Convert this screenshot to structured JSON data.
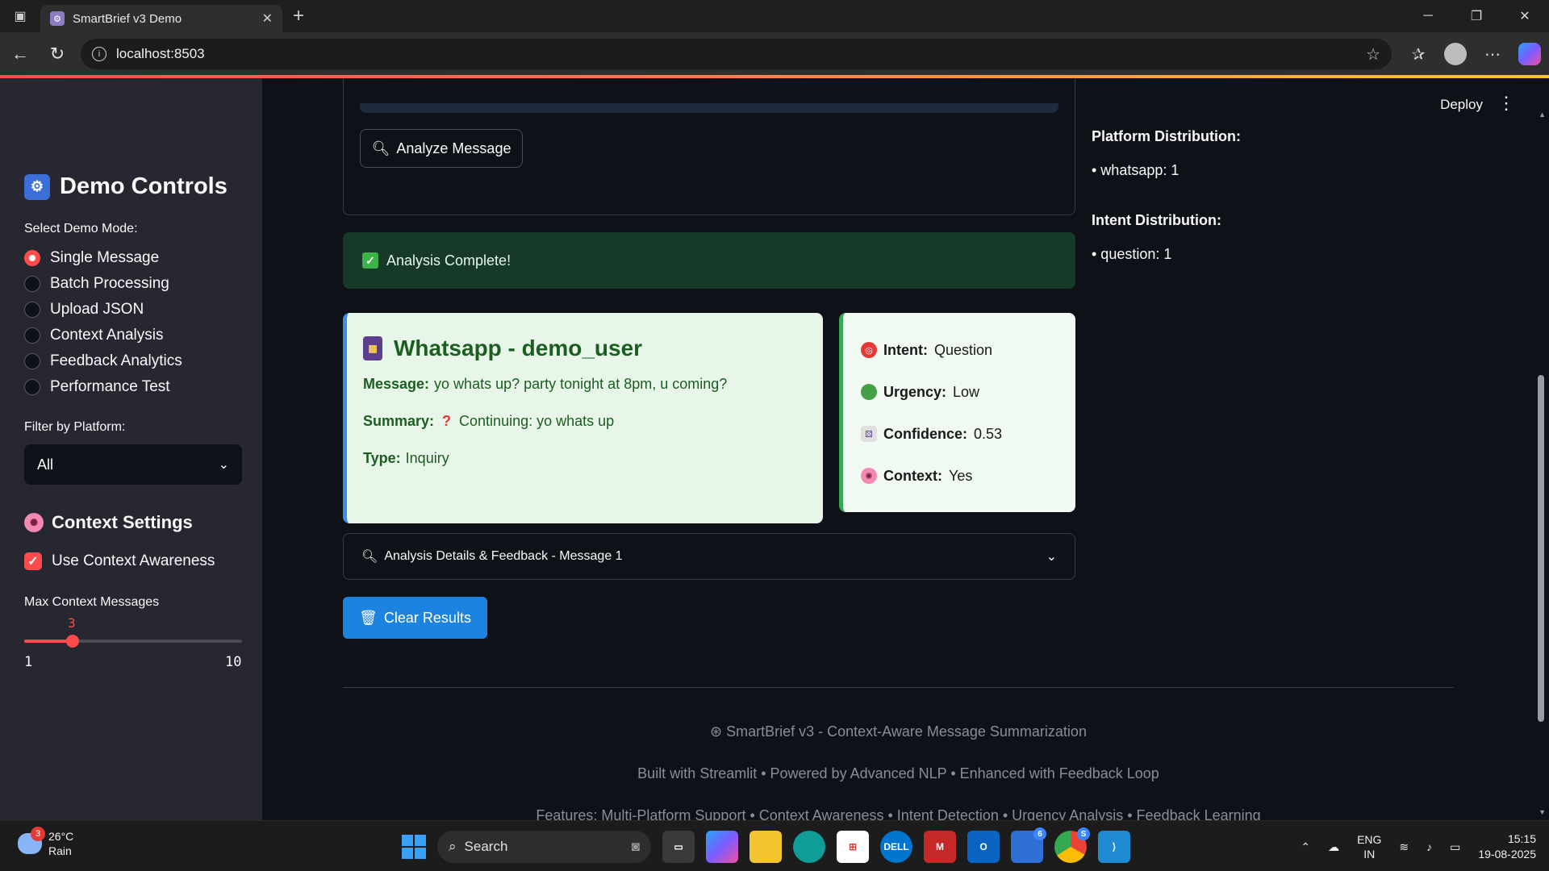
{
  "browser": {
    "tab_title": "SmartBrief v3 Demo",
    "url": "localhost:8503"
  },
  "colors": {
    "accent": "#ff4b4b",
    "primary_button": "#1c83e1",
    "success_bg": "#173928",
    "card_left_border": "#3d8ee8",
    "card_right_border": "#34a853"
  },
  "sidebar": {
    "title": "Demo Controls",
    "mode_label": "Select Demo Mode:",
    "modes": [
      {
        "label": "Single Message",
        "selected": true
      },
      {
        "label": "Batch Processing",
        "selected": false
      },
      {
        "label": "Upload JSON",
        "selected": false
      },
      {
        "label": "Context Analysis",
        "selected": false
      },
      {
        "label": "Feedback Analytics",
        "selected": false
      },
      {
        "label": "Performance Test",
        "selected": false
      }
    ],
    "platform_label": "Filter by Platform:",
    "platform_value": "All",
    "context_title": "Context Settings",
    "use_context_label": "Use Context Awareness",
    "use_context_checked": true,
    "max_context_label": "Max Context Messages",
    "slider": {
      "value": 3,
      "min": 1,
      "max": 10
    }
  },
  "header": {
    "deploy_label": "Deploy",
    "menu_icon": "kebab-icon"
  },
  "main": {
    "analyze_label": "Analyze Message",
    "success_text": "Analysis Complete!",
    "card": {
      "title": "Whatsapp - demo_user",
      "message_key": "Message:",
      "message_value": "yo whats up? party tonight at 8pm, u coming?",
      "summary_key": "Summary:",
      "summary_value": "Continuing: yo whats up",
      "type_key": "Type:",
      "type_value": "Inquiry"
    },
    "metrics": {
      "intent_key": "Intent:",
      "intent_value": "Question",
      "urgency_key": "Urgency:",
      "urgency_value": "Low",
      "confidence_key": "Confidence:",
      "confidence_value": "0.53",
      "context_key": "Context:",
      "context_value": "Yes"
    },
    "expander_label": "Analysis Details & Feedback - Message 1",
    "clear_label": "Clear Results"
  },
  "right_panel": {
    "platform_heading": "Platform Distribution:",
    "platform_item": "• whatsapp: 1",
    "intent_heading": "Intent Distribution:",
    "intent_item": "• question: 1"
  },
  "footer": {
    "line1": "SmartBrief v3 - Context-Aware Message Summarization",
    "line2": "Built with Streamlit • Powered by Advanced NLP • Enhanced with Feedback Loop",
    "line3": "Features: Multi-Platform Support • Context Awareness • Intent Detection • Urgency Analysis • Feedback Learning"
  },
  "taskbar": {
    "weather_badge": "3",
    "temperature": "26°C",
    "condition": "Rain",
    "search_placeholder": "Search",
    "store_badge": "6",
    "chrome_badge": "S",
    "lang_line1": "ENG",
    "lang_line2": "IN",
    "time": "15:15",
    "date": "19-08-2025"
  }
}
